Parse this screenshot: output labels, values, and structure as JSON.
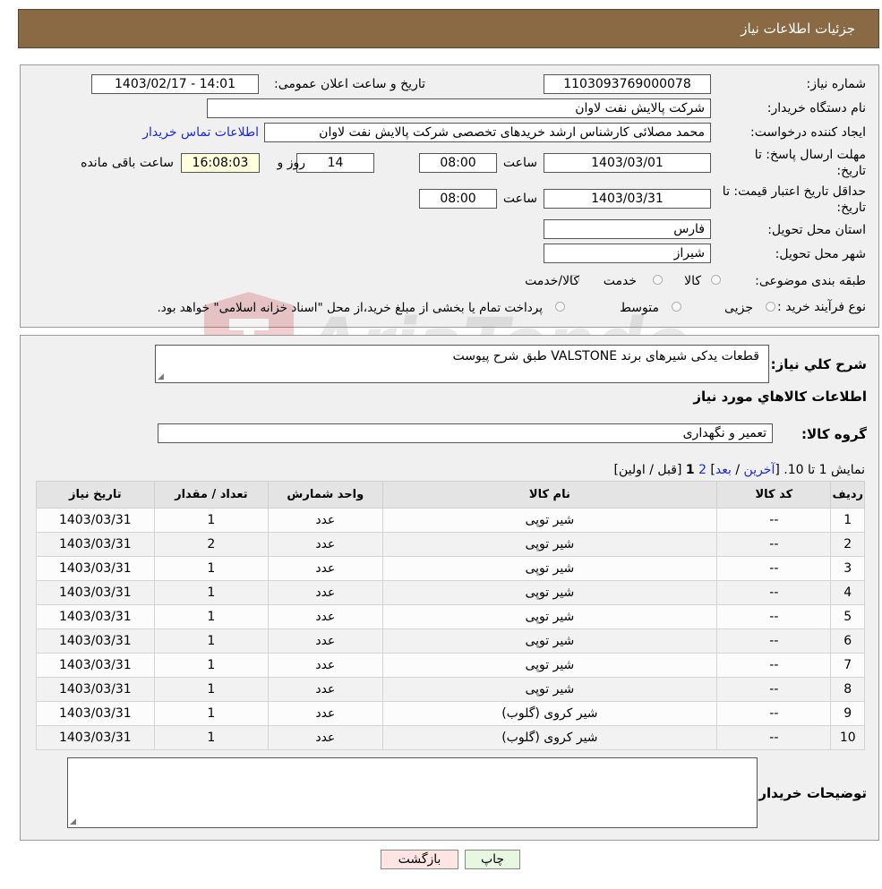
{
  "header": {
    "title": "جزئیات اطلاعات نیاز"
  },
  "info": {
    "need_number_label": "شماره نیاز:",
    "need_number": "1103093769000078",
    "announce_label": "تاریخ و ساعت اعلان عمومی:",
    "announce_value": "1403/02/17 - 14:01",
    "buyer_label": "نام دستگاه خریدار:",
    "buyer_value": "شرکت پالایش نفت لاوان",
    "creator_label": "ایجاد کننده درخواست:",
    "creator_value": "محمد مصلائی کارشناس ارشد خریدهای تخصصی شرکت پالایش نفت لاوان",
    "contact_link": "اطلاعات تماس خریدار",
    "deadline_label_1": "مهلت ارسال پاسخ: تا",
    "deadline_label_2": "تاریخ:",
    "deadline_date": "1403/03/01",
    "time_label": "ساعت",
    "deadline_time": "08:00",
    "days_value": "14",
    "days_label": "روز و",
    "remaining_time": "16:08:03",
    "remaining_label": "ساعت باقی مانده",
    "validity_label_1": "حداقل تاریخ اعتبار قیمت: تا",
    "validity_label_2": "تاریخ:",
    "validity_date": "1403/03/31",
    "validity_time": "08:00",
    "province_label": "استان محل تحویل:",
    "province_value": "فارس",
    "city_label": "شهر محل تحویل:",
    "city_value": "شیراز",
    "category_label": "طبقه بندی موضوعی:",
    "category_options": [
      "کالا",
      "خدمت",
      "کالا/خدمت"
    ],
    "process_label": "نوع فرآیند خرید :",
    "process_options": [
      "جزیی",
      "متوسط"
    ],
    "process_note": "پرداخت تمام یا بخشی از مبلغ خرید،از محل \"اسناد خزانه اسلامی\" خواهد بود."
  },
  "details": {
    "summary_label": "شرح کلي نياز:",
    "summary_value": "قطعات یدکی شیرهای برند VALSTONE طبق شرح پیوست",
    "goods_info_title": "اطلاعات کالاهاي مورد نياز",
    "group_label": "گروه کالا:",
    "group_value": "تعمیر و نگهداری",
    "pagination": {
      "showing": "نمایش 1 تا 10.",
      "last": "آخرین",
      "next": "بعد",
      "page2": "2",
      "page1": "1",
      "prev_first": "[قبل / اولین]"
    },
    "columns": [
      "ردیف",
      "کد کالا",
      "نام کالا",
      "واحد شمارش",
      "تعداد / مقدار",
      "تاریخ نیاز"
    ],
    "rows": [
      [
        "1",
        "--",
        "شیر توپی",
        "عدد",
        "1",
        "1403/03/31"
      ],
      [
        "2",
        "--",
        "شیر توپی",
        "عدد",
        "2",
        "1403/03/31"
      ],
      [
        "3",
        "--",
        "شیر توپی",
        "عدد",
        "1",
        "1403/03/31"
      ],
      [
        "4",
        "--",
        "شیر توپی",
        "عدد",
        "1",
        "1403/03/31"
      ],
      [
        "5",
        "--",
        "شیر توپی",
        "عدد",
        "1",
        "1403/03/31"
      ],
      [
        "6",
        "--",
        "شیر توپی",
        "عدد",
        "1",
        "1403/03/31"
      ],
      [
        "7",
        "--",
        "شیر توپی",
        "عدد",
        "1",
        "1403/03/31"
      ],
      [
        "8",
        "--",
        "شیر توپی",
        "عدد",
        "1",
        "1403/03/31"
      ],
      [
        "9",
        "--",
        "شیر کروی (گلوب)",
        "عدد",
        "1",
        "1403/03/31"
      ],
      [
        "10",
        "--",
        "شیر کروی (گلوب)",
        "عدد",
        "1",
        "1403/03/31"
      ]
    ],
    "buyer_notes_label": "توضیحات خریدار:",
    "buyer_notes_value": ""
  },
  "buttons": {
    "print": "چاپ",
    "back": "بازگشت"
  },
  "watermark": {
    "text": "AriaTender.neT"
  },
  "colors": {
    "header_bg": "#8a6a44",
    "link": "#1a28d6",
    "back_btn": "#ffe4e4",
    "print_btn": "#e8f7e0"
  }
}
